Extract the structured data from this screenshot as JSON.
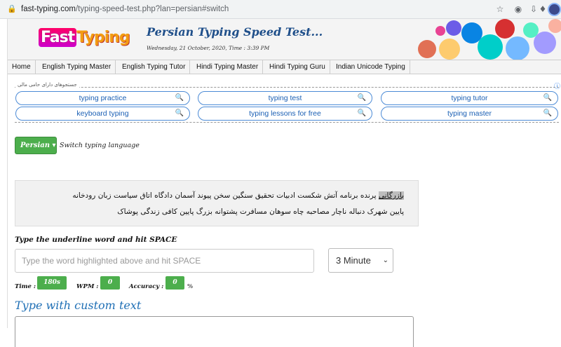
{
  "browser": {
    "url_host": "fast-typing.com",
    "url_path": "/typing-speed-test.php?lan=persian#switch"
  },
  "header": {
    "logo_fast": "Fast",
    "logo_typing": "Typing",
    "title": "Persian Typing Speed Test...",
    "datetime": "Wednesday, 21 October, 2020, Time : 3:39 PM"
  },
  "nav": {
    "items": [
      "Home",
      "English Typing Master",
      "English Typing Tutor",
      "Hindi Typing Master",
      "Hindi Typing Guru",
      "Indian Unicode Typing"
    ]
  },
  "ads": {
    "title": "جستجوهای دارای حامی مالی",
    "items": [
      "typing practice",
      "typing test",
      "typing tutor",
      "keyboard typing",
      "typing lessons for free",
      "typing master"
    ]
  },
  "language": {
    "button": "Persian",
    "label": "Switch typing language"
  },
  "practice": {
    "highlight": "بازرگانی",
    "line1_rest": "پرنده برنامه آتش شکست ادبیات تحقیق سنگین سخن پیوند آسمان دادگاه اتاق سیاست زبان رودخانه",
    "line2": "پایین شهرک دنباله ناچار مصاحبه چاه سوهان مسافرت پشتوانه بزرگ پایین کافی زندگی پوشاک"
  },
  "input": {
    "prompt": "Type the underline word and hit SPACE",
    "placeholder": "Type the word highlighted above and hit SPACE",
    "duration": "3 Minute"
  },
  "stats": {
    "time_label": "Time :",
    "time_value": "180s",
    "wpm_label": "WPM :",
    "wpm_value": "0",
    "accuracy_label": "Accuracy :",
    "accuracy_value": "0",
    "percent": "%"
  },
  "custom": {
    "heading": "Type with custom text"
  }
}
